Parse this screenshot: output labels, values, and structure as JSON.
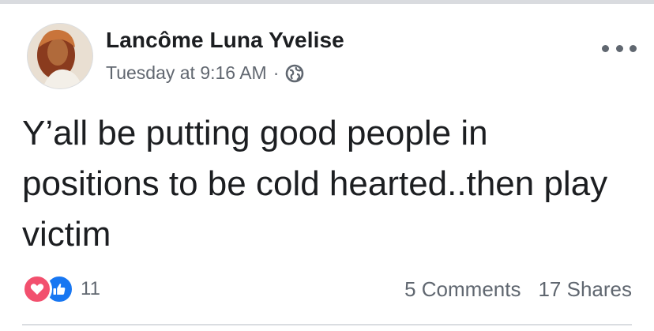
{
  "post": {
    "author": "Lancôme Luna Yvelise",
    "timestamp": "Tuesday at 9:16 AM",
    "separator": "·",
    "privacy_icon": "globe-icon",
    "menu_icon": "more-options-icon",
    "text": "Y’all be putting good people in positions to be cold hearted..then play victim",
    "reactions": {
      "icons": [
        "love-reaction-icon",
        "like-reaction-icon"
      ],
      "count": "11"
    },
    "comments": "5 Comments",
    "shares": "17 Shares"
  },
  "colors": {
    "love": "#f2506e",
    "like": "#1877f2",
    "meta_text": "#616770",
    "body_text": "#1c1e21"
  }
}
